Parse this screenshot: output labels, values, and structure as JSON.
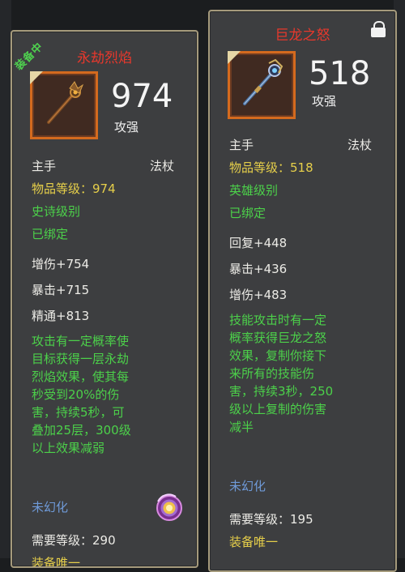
{
  "left_card": {
    "badge": "装备中",
    "title": "永劫烈焰",
    "item_level_value": "974",
    "stat_label": "攻强",
    "slot": "主手",
    "weapon_type": "法杖",
    "item_level_line": "物品等级：974",
    "rarity": "史诗级别",
    "bind": "已绑定",
    "stats": [
      "增伤+754",
      "暴击+715",
      "精通+813"
    ],
    "effect": "攻击有一定概率使\n目标获得一层永劫\n烈焰效果，使其每\n秒受到20%的伤\n害，持续5秒，可\n叠加25层，300级\n以上效果减弱",
    "transmog": "未幻化",
    "required_level": "需要等级：290",
    "unique": "装备唯一"
  },
  "right_card": {
    "title": "巨龙之怒",
    "item_level_value": "518",
    "stat_label": "攻强",
    "slot": "主手",
    "weapon_type": "法杖",
    "item_level_line": "物品等级：518",
    "rarity": "英雄级别",
    "bind": "已绑定",
    "stats": [
      "回复+448",
      "暴击+436",
      "增伤+483"
    ],
    "effect": "技能攻击时有一定\n概率获得巨龙之怒\n效果，复制你接下\n来所有的技能伤\n害，持续3秒，250\n级以上复制的伤害\n减半",
    "transmog": "未幻化",
    "required_level": "需要等级：195",
    "unique": "装备唯一"
  },
  "icons": {
    "left_item": "fire-staff-icon",
    "right_item": "dragon-staff-icon",
    "lock": "lock-icon",
    "transmog_orb": "transmog-orb-icon"
  },
  "colors": {
    "title_red": "#e8382c",
    "rarity_green": "#4cd14a",
    "level_yellow": "#e6cf4a",
    "transmog_blue": "#6f9ad8",
    "frame_orange": "#d46a1e",
    "card_border": "#a59a7c"
  }
}
